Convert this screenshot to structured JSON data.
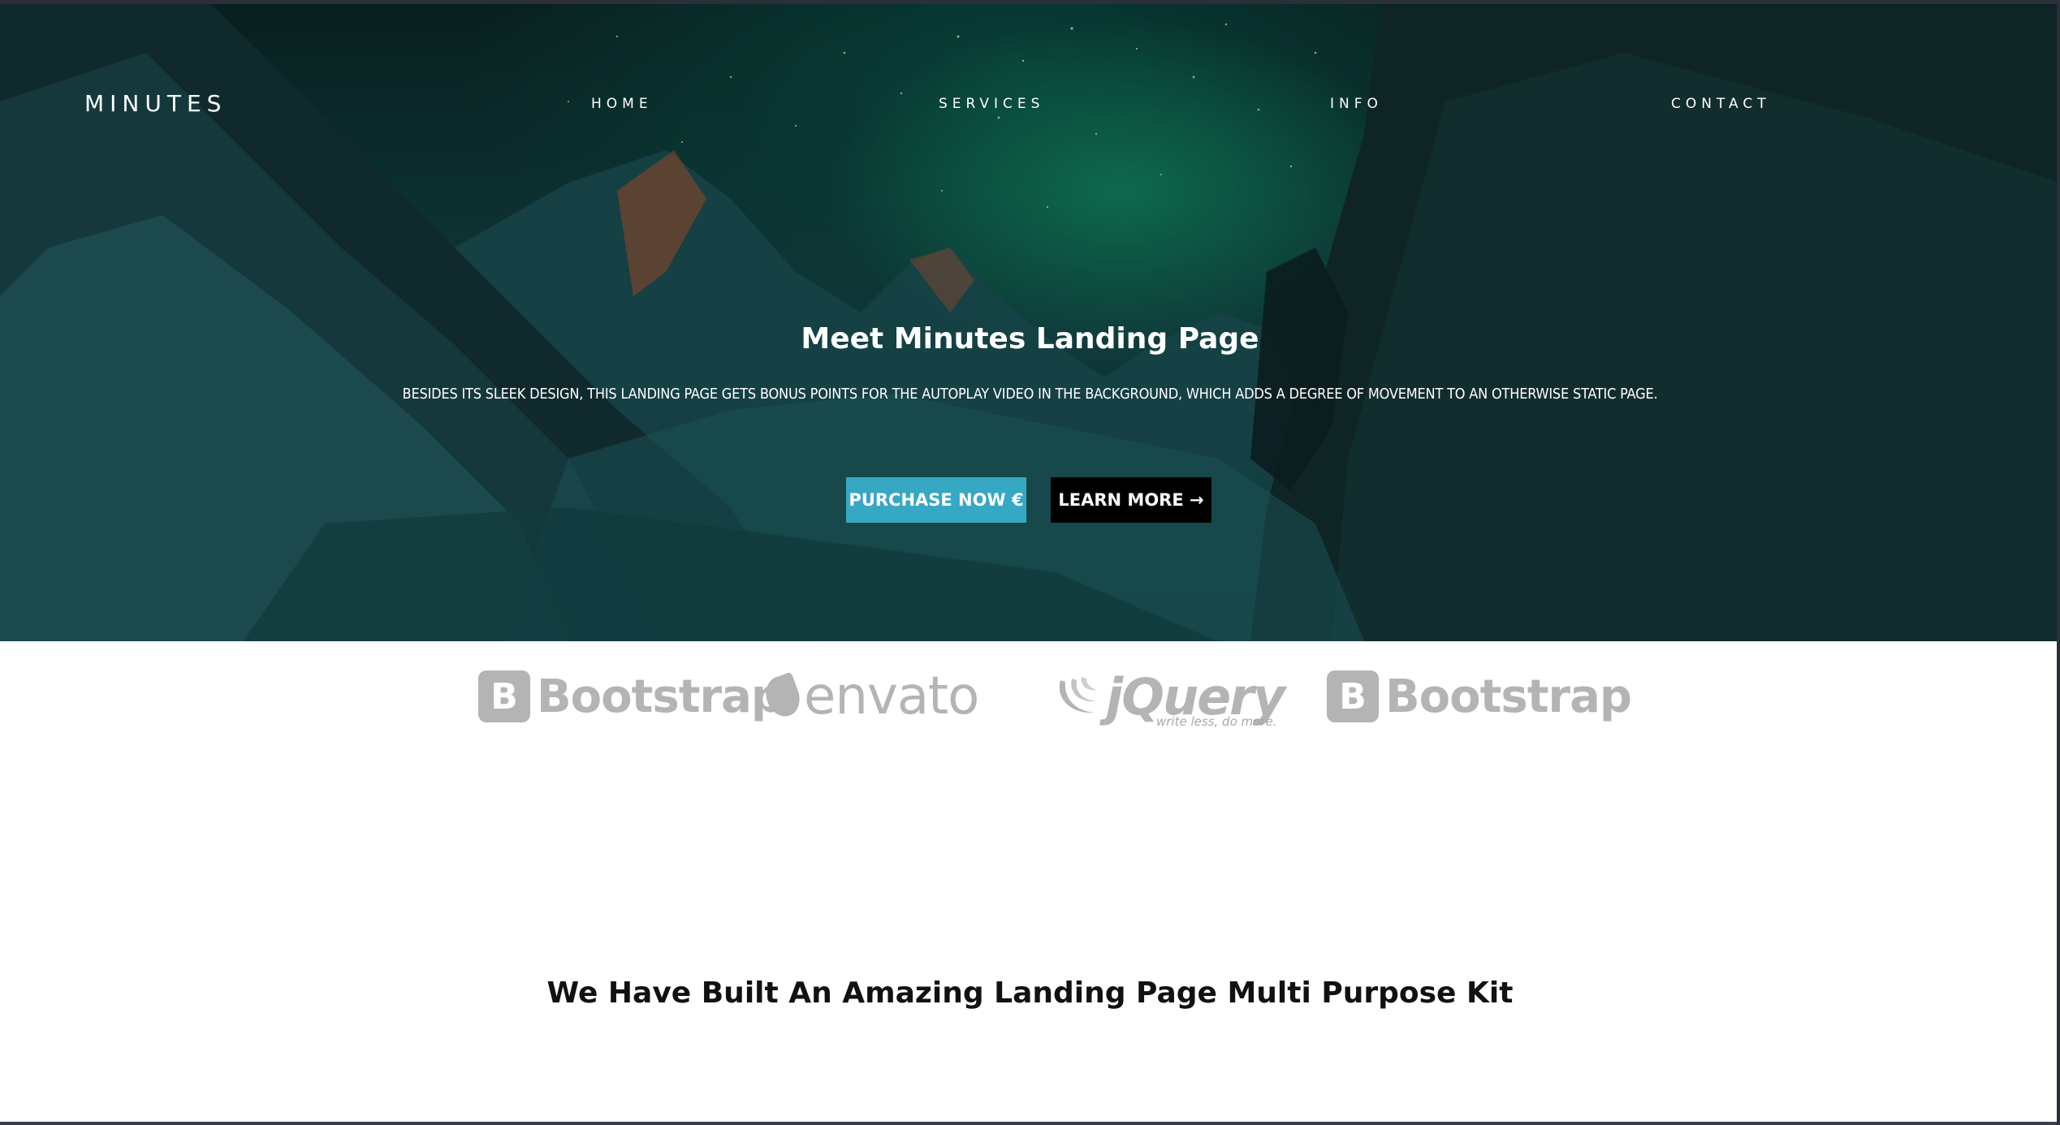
{
  "brand": {
    "logo_text": "MINUTES"
  },
  "nav": {
    "items": [
      {
        "label": "HOME"
      },
      {
        "label": "SERVICES"
      },
      {
        "label": "INFO"
      },
      {
        "label": "CONTACT"
      }
    ]
  },
  "hero": {
    "title": "Meet Minutes Landing Page",
    "subtitle": "BESIDES ITS SLEEK DESIGN, THIS LANDING PAGE GETS BONUS POINTS FOR THE AUTOPLAY VIDEO IN THE BACKGROUND, WHICH ADDS A DEGREE OF MOVEMENT TO AN OTHERWISE STATIC PAGE.",
    "purchase_label": "PURCHASE NOW €",
    "learn_label": "LEARN MORE →"
  },
  "partners": {
    "items": [
      {
        "name": "Bootstrap",
        "mark": "B"
      },
      {
        "name": "envato"
      },
      {
        "name": "jQuery",
        "tagline": "write less, do more."
      },
      {
        "name": "Bootstrap",
        "mark": "B"
      }
    ]
  },
  "features": {
    "title": "We Have Built An Amazing Landing Page Multi Purpose Kit"
  },
  "colors": {
    "accent": "#37a8c4",
    "button_dark": "#000000",
    "partner_gray": "#b4b4b4"
  }
}
